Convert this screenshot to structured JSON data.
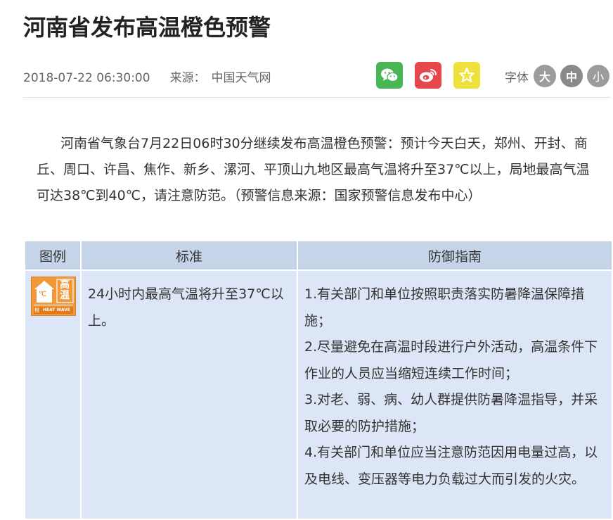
{
  "article": {
    "title": "河南省发布高温橙色预警",
    "date": "2018-07-22 06:30:00",
    "source_label": "来源：",
    "source_value": "中国天气网",
    "body": "河南省气象台7月22日06时30分继续发布高温橙色预警：预计今天白天，郑州、开封、商丘、周口、许昌、焦作、新乡、漯河、平顶山九地区最高气温将升至37℃以上，局地最高气温可达38℃到40℃，请注意防范。（预警信息来源：国家预警信息发布中心）"
  },
  "share": {
    "icons": [
      "wechat-icon",
      "weibo-icon",
      "favorite-star-icon"
    ],
    "colors": {
      "wechat": "#48b655",
      "weibo": "#e5474a",
      "favorite": "#efe13c"
    }
  },
  "font_size": {
    "label": "字体",
    "large": "大",
    "medium": "中",
    "small": "小"
  },
  "warning_table": {
    "headers": [
      "图例",
      "标准",
      "防御指南"
    ],
    "icon": {
      "text_top": "高",
      "text_bottom": "温",
      "unit": "℃",
      "level": "橙",
      "caption": "HEAT WAVE",
      "color": "#f0983a"
    },
    "standard": "24小时内最高气温将升至37℃以上。",
    "guides": [
      "1.有关部门和单位按照职责落实防暑降温保障措施；",
      "2.尽量避免在高温时段进行户外活动，高温条件下作业的人员应当缩短连续工作时间；",
      "3.对老、弱、病、幼人群提供防暑降温指导，并采取必要的防护措施；",
      "4.有关部门和单位应当注意防范因用电量过高，以及电线、变压器等电力负载过大而引发的火灾。"
    ]
  }
}
